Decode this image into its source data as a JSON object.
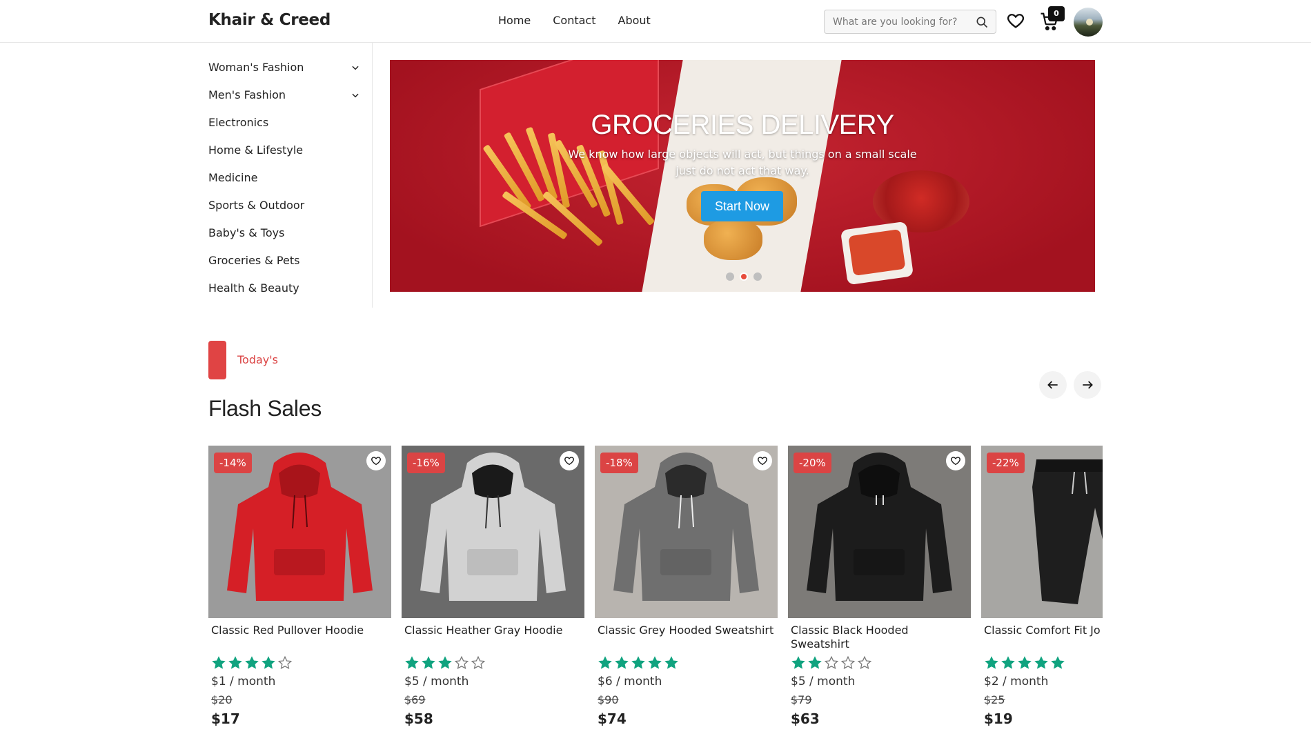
{
  "header": {
    "logo": "Khair & Creed",
    "nav": [
      "Home",
      "Contact",
      "About"
    ],
    "search_placeholder": "What are you looking for?",
    "cart_count": "0"
  },
  "sidebar": {
    "items": [
      {
        "label": "Woman's Fashion",
        "has_submenu": true
      },
      {
        "label": "Men's Fashion",
        "has_submenu": true
      },
      {
        "label": "Electronics",
        "has_submenu": false
      },
      {
        "label": "Home & Lifestyle",
        "has_submenu": false
      },
      {
        "label": "Medicine",
        "has_submenu": false
      },
      {
        "label": "Sports & Outdoor",
        "has_submenu": false
      },
      {
        "label": "Baby's & Toys",
        "has_submenu": false
      },
      {
        "label": "Groceries & Pets",
        "has_submenu": false
      },
      {
        "label": "Health & Beauty",
        "has_submenu": false
      }
    ]
  },
  "banner": {
    "title": "GROCERIES DELIVERY",
    "subtitle": "We know how large objects will act, but things on a small scale just do not act that way.",
    "button": "Start Now",
    "slides": 3,
    "active_slide": 2
  },
  "section": {
    "tag": "Today's",
    "title": "Flash Sales"
  },
  "colors": {
    "accent": "#db4444",
    "star": "#10a37f",
    "button": "#1e9be3"
  },
  "products": [
    {
      "name": "Classic Red Pullover Hoodie",
      "discount": "-14%",
      "rating": 4,
      "monthly": "$1 / month",
      "old_price": "$20",
      "price": "$17",
      "color": "#d51f26",
      "bg": "#9b9b9b"
    },
    {
      "name": "Classic Heather Gray Hoodie",
      "discount": "-16%",
      "rating": 3,
      "monthly": "$5 / month",
      "old_price": "$69",
      "price": "$58",
      "color": "#cfcfcf",
      "bg": "#5e5e5e"
    },
    {
      "name": "Classic Grey Hooded Sweatshirt",
      "discount": "-18%",
      "rating": 5,
      "monthly": "$6 / month",
      "old_price": "$90",
      "price": "$74",
      "color": "#6f6f6f",
      "bg": "#b8b4af"
    },
    {
      "name": "Classic Black Hooded Sweatshirt",
      "discount": "-20%",
      "rating": 2,
      "monthly": "$5 / month",
      "old_price": "$79",
      "price": "$63",
      "color": "#1c1c1c",
      "bg": "#7d7b78"
    },
    {
      "name": "Classic Comfort Fit Jo",
      "discount": "-22%",
      "rating": 5,
      "monthly": "$2 / month",
      "old_price": "$25",
      "price": "$19",
      "color": "#1e1e1e",
      "bg": "#a7a6a3"
    }
  ]
}
